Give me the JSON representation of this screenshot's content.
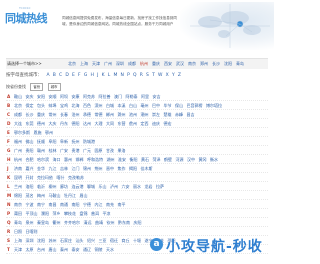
{
  "logo": {
    "brand": "同城热线",
    "slogan": "TC0010"
  },
  "intro": "同城信息网提供免费发布，海量信息每日更新，找房子找工作找信息到同城，是你身边的同城信息网站，同城热线全国站点，服务千万同城用户",
  "city_hint": {
    "label": "请选择一个城市>>",
    "hot": [
      {
        "name": "北京",
        "hl": false
      },
      {
        "name": "上海",
        "hl": false
      },
      {
        "name": "天津",
        "hl": false
      },
      {
        "name": "广州",
        "hl": false
      },
      {
        "name": "深圳",
        "hl": false
      },
      {
        "name": "成都",
        "hl": false
      },
      {
        "name": "杭州",
        "hl": true
      },
      {
        "name": "重庆",
        "hl": false
      },
      {
        "name": "西安",
        "hl": false
      },
      {
        "name": "武汉",
        "hl": false
      },
      {
        "name": "南京",
        "hl": false
      },
      {
        "name": "郑州",
        "hl": false
      },
      {
        "name": "长沙",
        "hl": false
      },
      {
        "name": "沈阳",
        "hl": false
      },
      {
        "name": "青岛",
        "hl": false
      }
    ]
  },
  "letters": {
    "label": "按字母查找城市：",
    "items": [
      "A",
      "B",
      "C",
      "D",
      "E",
      "F",
      "G",
      "H",
      "J",
      "K",
      "L",
      "M",
      "N",
      "P",
      "Q",
      "R",
      "S",
      "T",
      "W",
      "X",
      "Y",
      "Z"
    ]
  },
  "search": {
    "label": "按省份查找",
    "province": "省份",
    "city": "城市"
  },
  "sections": [
    {
      "title": "",
      "rows": [
        {
          "letter": "A",
          "cities": [
            "鞍山",
            "安庆",
            "安阳",
            "安顺",
            "阿坝",
            "安康",
            "阿克苏",
            "阿拉善",
            "澳门",
            "阿勒泰",
            "阿里",
            "安吉"
          ]
        },
        {
          "letter": "B",
          "cities": [
            "北京",
            "保定",
            "包头",
            "蚌埠",
            "宝鸡",
            "北海",
            "百色",
            "滨州",
            "白城",
            "本溪",
            "白山",
            "亳州",
            "巴中",
            "毕节",
            "保山",
            "巴音郭楞",
            "博尔塔拉"
          ]
        },
        {
          "letter": "C",
          "cities": [
            "成都",
            "长沙",
            "重庆",
            "常州",
            "长春",
            "沧州",
            "承德",
            "常德",
            "郴州",
            "滁州",
            "池州",
            "潮州",
            "崇左",
            "楚雄",
            "赤峰",
            "昌吉"
          ]
        },
        {
          "letter": "D",
          "cities": [
            "大连",
            "东莞",
            "德州",
            "大庆",
            "丹东",
            "德阳",
            "达州",
            "大理",
            "大同",
            "东营",
            "儋州",
            "定西",
            "迪庆",
            "德宏"
          ]
        },
        {
          "letter": "E",
          "cities": [
            "鄂尔多斯",
            "恩施",
            "鄂州"
          ]
        },
        {
          "letter": "F",
          "cities": [
            "福州",
            "佛山",
            "抚顺",
            "阜阳",
            "阜新",
            "抚州",
            "防城港"
          ]
        },
        {
          "letter": "G",
          "cities": [
            "广州",
            "贵阳",
            "赣州",
            "桂林",
            "广安",
            "贵港",
            "广元",
            "固原",
            "甘孜",
            "果洛"
          ]
        },
        {
          "letter": "H",
          "cities": [
            "杭州",
            "合肥",
            "哈尔滨",
            "海口",
            "惠州",
            "邯郸",
            "呼和浩特",
            "湖州",
            "淮安",
            "衡阳",
            "黄石",
            "菏泽",
            "鹤壁",
            "河源",
            "汉中",
            "黄冈",
            "衡水"
          ]
        },
        {
          "letter": "J",
          "cities": [
            "济南",
            "嘉兴",
            "金华",
            "九江",
            "吉林",
            "江门",
            "锦州",
            "荆州",
            "晋中",
            "焦作",
            "揭阳",
            "佳木斯"
          ]
        },
        {
          "letter": "K",
          "cities": [
            "昆明",
            "开封",
            "克拉玛依",
            "喀什",
            "克孜勒苏"
          ]
        },
        {
          "letter": "L",
          "cities": [
            "兰州",
            "洛阳",
            "临沂",
            "柳州",
            "廊坊",
            "连云港",
            "聊城",
            "乐山",
            "泸州",
            "六安",
            "丽水",
            "龙岩",
            "拉萨"
          ]
        },
        {
          "letter": "M",
          "cities": [
            "绵阳",
            "茂名",
            "梅州",
            "马鞍山",
            "牡丹江",
            "眉山"
          ]
        },
        {
          "letter": "N",
          "cities": [
            "南京",
            "宁波",
            "南宁",
            "南昌",
            "南通",
            "南阳",
            "宁德",
            "内江",
            "南充",
            "南平"
          ]
        },
        {
          "letter": "P",
          "cities": [
            "莆田",
            "平顶山",
            "濮阳",
            "萍乡",
            "攀枝花",
            "盘锦",
            "普洱",
            "平凉"
          ]
        },
        {
          "letter": "Q",
          "cities": [
            "青岛",
            "泉州",
            "秦皇岛",
            "衢州",
            "齐齐哈尔",
            "清远",
            "曲靖",
            "钦州",
            "黔东南",
            "庆阳"
          ]
        },
        {
          "letter": "R",
          "cities": [
            "日照",
            "日喀则"
          ]
        },
        {
          "letter": "S",
          "cities": [
            "上海",
            "深圳",
            "沈阳",
            "苏州",
            "石家庄",
            "汕头",
            "绍兴",
            "三亚",
            "宿迁",
            "商丘",
            "十堰",
            "遂宁",
            "韶关",
            "邵阳"
          ]
        },
        {
          "letter": "T",
          "cities": [
            "天津",
            "太原",
            "台州",
            "唐山",
            "泰州",
            "泰安",
            "通辽",
            "铜陵",
            "天水"
          ]
        }
      ]
    }
  ],
  "watermark": {
    "badge": "a",
    "text": "小攻导航-秒收"
  }
}
